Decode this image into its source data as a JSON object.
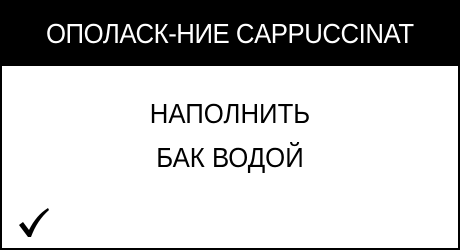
{
  "header": {
    "title": "ОПОЛАСК-НИЕ CAPPUCCINAT"
  },
  "message": {
    "line1": "НАПОЛНИТЬ",
    "line2": "БАК ВОДОЙ"
  },
  "actions": {
    "confirm_icon": "checkmark-icon"
  },
  "colors": {
    "background": "#ffffff",
    "header_background": "#000000",
    "header_text": "#ffffff",
    "text": "#000000"
  }
}
